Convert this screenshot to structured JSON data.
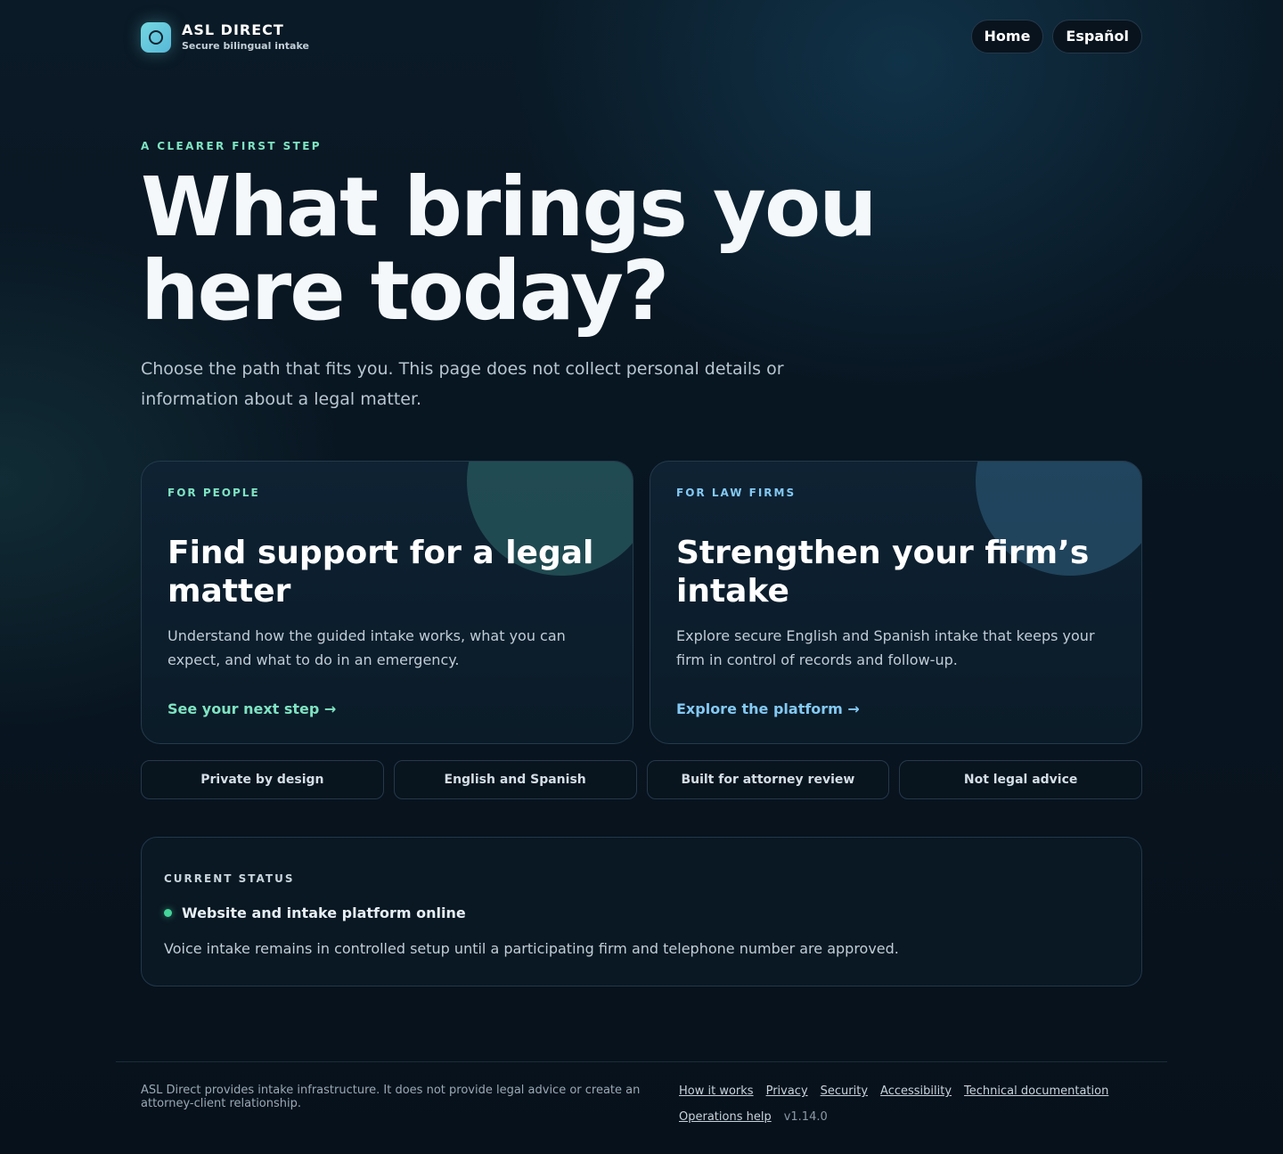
{
  "header": {
    "brand_name": "ASL DIRECT",
    "brand_tagline": "Secure bilingual intake",
    "nav": [
      {
        "label": "Home"
      },
      {
        "label": "Español"
      }
    ]
  },
  "hero": {
    "eyebrow": "A CLEARER FIRST STEP",
    "title": "What brings you here today?",
    "lede": "Choose the path that fits you. This page does not collect personal details or information about a legal matter."
  },
  "cards": [
    {
      "kicker": "FOR PEOPLE",
      "title": "Find support for a legal matter",
      "body": "Understand how the guided intake works, what you can expect, and what to do in an emergency.",
      "cta": "See your next step →"
    },
    {
      "kicker": "FOR LAW FIRMS",
      "title": "Strengthen your firm’s intake",
      "body": "Explore secure English and Spanish intake that keeps your firm in control of records and follow-up.",
      "cta": "Explore the platform →"
    }
  ],
  "pills": [
    "Private by design",
    "English and Spanish",
    "Built for attorney review",
    "Not legal advice"
  ],
  "status": {
    "kicker": "CURRENT STATUS",
    "headline": "Website and intake platform online",
    "note": "Voice intake remains in controlled setup until a participating firm and telephone number are approved.",
    "indicator_color": "#45d49a"
  },
  "footer": {
    "disclaimer": "ASL Direct provides intake infrastructure. It does not provide legal advice or create an attorney-client relationship.",
    "links": [
      "How it works",
      "Privacy",
      "Security",
      "Accessibility",
      "Technical documentation",
      "Operations help"
    ],
    "version": "v1.14.0"
  },
  "colors": {
    "accent_people": "#7fe3c2",
    "accent_firms": "#84c9f3",
    "background": "#07111b"
  }
}
